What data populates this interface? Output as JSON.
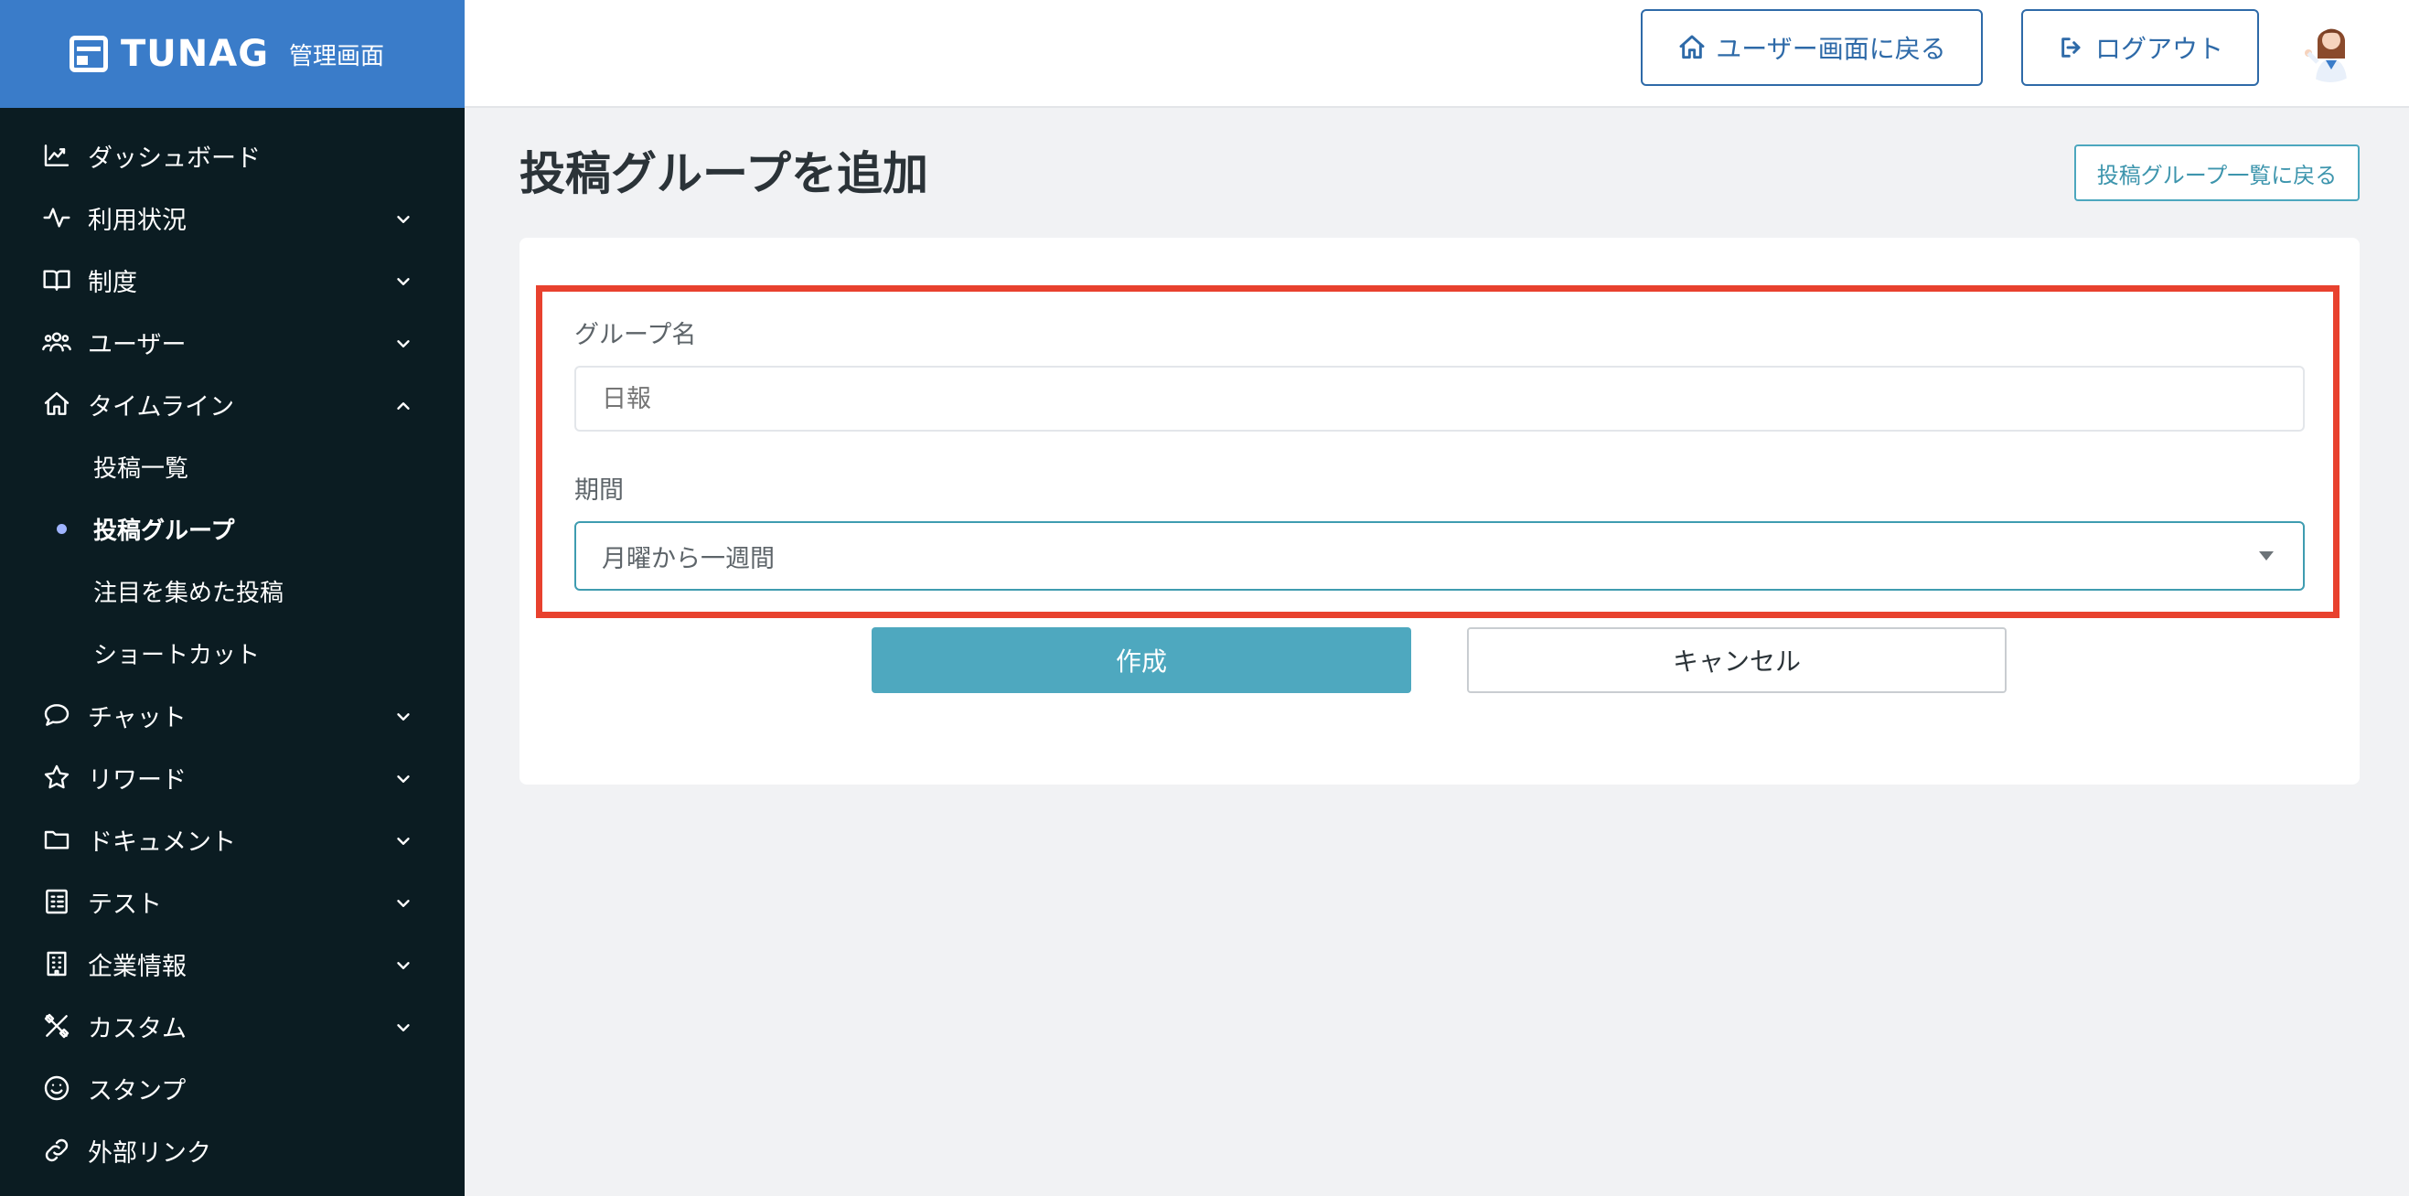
{
  "brand": {
    "name": "TUNAG",
    "subtitle": "管理画面"
  },
  "sidebar": {
    "items": [
      {
        "label": "ダッシュボード",
        "icon": "chart-trend-icon"
      },
      {
        "label": "利用状況",
        "icon": "activity-icon",
        "expandable": true
      },
      {
        "label": "制度",
        "icon": "book-icon",
        "expandable": true
      },
      {
        "label": "ユーザー",
        "icon": "users-icon",
        "expandable": true
      },
      {
        "label": "タイムライン",
        "icon": "home-icon",
        "expanded": true
      },
      {
        "label": "チャット",
        "icon": "chat-bubble-icon",
        "expandable": true
      },
      {
        "label": "リワード",
        "icon": "star-icon",
        "expandable": true
      },
      {
        "label": "ドキュメント",
        "icon": "folder-icon",
        "expandable": true
      },
      {
        "label": "テスト",
        "icon": "checklist-icon",
        "expandable": true
      },
      {
        "label": "企業情報",
        "icon": "building-icon",
        "expandable": true
      },
      {
        "label": "カスタム",
        "icon": "tools-icon",
        "expandable": true
      },
      {
        "label": "スタンプ",
        "icon": "smile-icon"
      },
      {
        "label": "外部リンク",
        "icon": "link-icon"
      }
    ],
    "timeline_sub": [
      {
        "label": "投稿一覧"
      },
      {
        "label": "投稿グループ",
        "active": true
      },
      {
        "label": "注目を集めた投稿"
      },
      {
        "label": "ショートカット"
      }
    ]
  },
  "topbar": {
    "back_to_user_label": "ユーザー画面に戻る",
    "logout_label": "ログアウト"
  },
  "main": {
    "title": "投稿グループを追加",
    "back_to_list_label": "投稿グループ一覧に戻る",
    "form": {
      "group_name_label": "グループ名",
      "group_name_placeholder": "日報",
      "period_label": "期間",
      "period_selected": "月曜から一週間",
      "create_label": "作成",
      "cancel_label": "キャンセル"
    }
  },
  "colors": {
    "brand_blue": "#3a7cc9",
    "sidebar_bg": "#0b1c22",
    "accent_teal": "#4ea8bf",
    "highlight_red": "#e8412e"
  }
}
